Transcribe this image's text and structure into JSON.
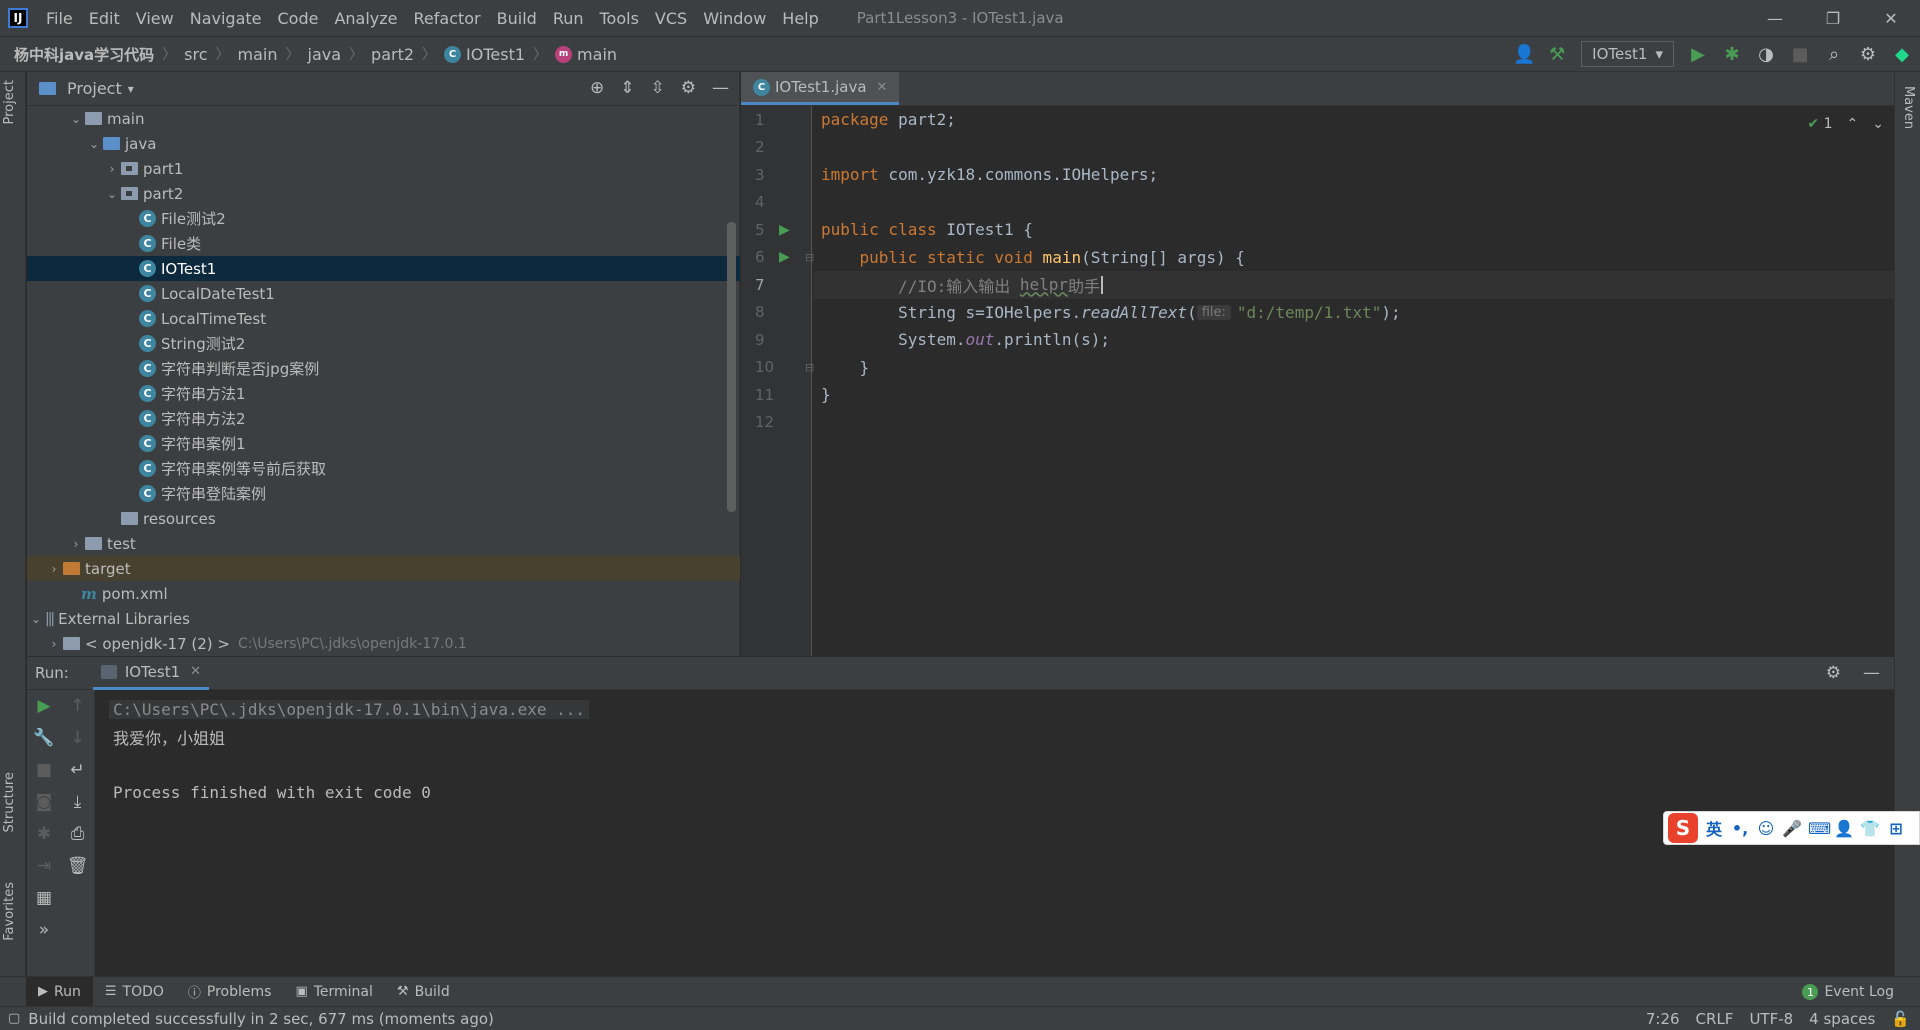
{
  "titlebar": {
    "menu": [
      "File",
      "Edit",
      "View",
      "Navigate",
      "Code",
      "Analyze",
      "Refactor",
      "Build",
      "Run",
      "Tools",
      "VCS",
      "Window",
      "Help"
    ],
    "window_title": "Part1Lesson3 - IOTest1.java",
    "minimize": "—",
    "restore": "❐",
    "close": "✕"
  },
  "navbar": {
    "crumbs": [
      "杨中科java学习代码",
      "src",
      "main",
      "java",
      "part2",
      "IOTest1",
      "main"
    ],
    "run_config": "IOTest1"
  },
  "project": {
    "title": "Project",
    "tree": [
      {
        "label": "main"
      },
      {
        "label": "java"
      },
      {
        "label": "part1"
      },
      {
        "label": "part2"
      },
      {
        "label": "File测试2"
      },
      {
        "label": "File类"
      },
      {
        "label": "IOTest1"
      },
      {
        "label": "LocalDateTest1"
      },
      {
        "label": "LocalTimeTest"
      },
      {
        "label": "String测试2"
      },
      {
        "label": "字符串判断是否jpg案例"
      },
      {
        "label": "字符串方法1"
      },
      {
        "label": "字符串方法2"
      },
      {
        "label": "字符串案例1"
      },
      {
        "label": "字符串案例等号前后获取"
      },
      {
        "label": "字符串登陆案例"
      },
      {
        "label": "resources"
      },
      {
        "label": "test"
      },
      {
        "label": "target"
      },
      {
        "label": "pom.xml"
      },
      {
        "label": "External Libraries"
      },
      {
        "label": "< openjdk-17 (2) >",
        "hint": "C:\\Users\\PC\\.jdks\\openjdk-17.0.1"
      }
    ]
  },
  "editor": {
    "tab": "IOTest1.java",
    "line_numbers": [
      "1",
      "2",
      "3",
      "4",
      "5",
      "6",
      "7",
      "8",
      "9",
      "10",
      "11",
      "12"
    ],
    "inspection_count": "1",
    "code": {
      "l1_kw": "package",
      "l1_rest": " part2;",
      "l3_kw": "import",
      "l3_rest": " com.yzk18.commons.IOHelpers;",
      "l5_kw": "public class",
      "l5_rest": " IOTest1 {",
      "l6_indent": "    ",
      "l6_kw": "public static void",
      "l6_fn": " main",
      "l6_rest": "(String[] args) {",
      "l7_indent": "        ",
      "l7_cmt": "//IO:输入输出 ",
      "l7_squig": "helpr",
      "l7_cmt2": "助手",
      "l8_indent": "        ",
      "l8_a": "String s=IOHelpers.",
      "l8_method": "readAllText",
      "l8_paren": "(",
      "l8_hint": "file:",
      "l8_str": "\"d:/temp/1.txt\"",
      "l8_end": ");",
      "l9_indent": "        ",
      "l9_a": "System.",
      "l9_field": "out",
      "l9_b": ".println(s);",
      "l10": "    }",
      "l11": "}"
    }
  },
  "run": {
    "label": "Run:",
    "tab": "IOTest1",
    "console": [
      "C:\\Users\\PC\\.jdks\\openjdk-17.0.1\\bin\\java.exe ...",
      "我爱你，小姐姐",
      "",
      "Process finished with exit code 0"
    ]
  },
  "left_stripe": {
    "project": "Project",
    "structure": "Structure",
    "favorites": "Favorites"
  },
  "right_stripe": {
    "maven": "Maven"
  },
  "toolwindows": [
    "Run",
    "TODO",
    "Problems",
    "Terminal",
    "Build"
  ],
  "event_log": {
    "badge": "1",
    "label": "Event Log"
  },
  "status": {
    "message": "Build completed successfully in 2 sec, 677 ms (moments ago)",
    "position": "7:26",
    "line_sep": "CRLF",
    "encoding": "UTF-8",
    "indent": "4 spaces"
  },
  "ime": {
    "logo": "S",
    "mode": "英"
  },
  "colors": {
    "accent": "#4a88c7",
    "selection": "#0d293e",
    "run_green": "#499c54",
    "keyword": "#cc7832",
    "string": "#6a8759"
  }
}
